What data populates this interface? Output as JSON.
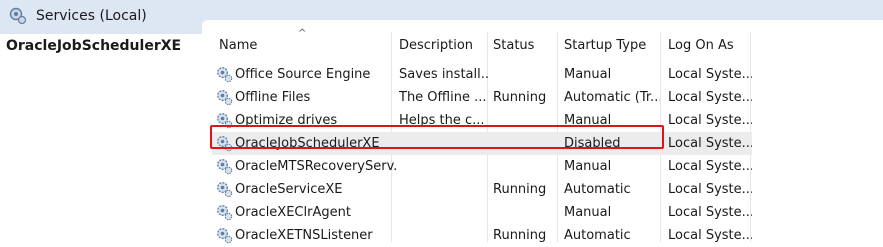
{
  "header": {
    "title": "Services (Local)",
    "icon": "services-icon"
  },
  "left_pane": {
    "selected_service": "OracleJobSchedulerXE"
  },
  "columns": [
    "Name",
    "Description",
    "Status",
    "Startup Type",
    "Log On As"
  ],
  "rows": [
    {
      "name": "Office  Source Engine",
      "description": "Saves install...",
      "status": "",
      "startup": "Manual",
      "logon": "Local Syste..."
    },
    {
      "name": "Offline Files",
      "description": "The Offline ...",
      "status": "Running",
      "startup": "Automatic (Tr...",
      "logon": "Local Syste..."
    },
    {
      "name": "Optimize drives",
      "description": "Helps the c...",
      "status": "",
      "startup": "Manual",
      "logon": "Local Syste..."
    },
    {
      "name": "OracleJobSchedulerXE",
      "description": "",
      "status": "",
      "startup": "Disabled",
      "logon": "Local Syste..."
    },
    {
      "name": "OracleMTSRecoveryServ...",
      "description": "",
      "status": "",
      "startup": "Manual",
      "logon": "Local Syste..."
    },
    {
      "name": "OracleServiceXE",
      "description": "",
      "status": "Running",
      "startup": "Automatic",
      "logon": "Local Syste..."
    },
    {
      "name": "OracleXEClrAgent",
      "description": "",
      "status": "",
      "startup": "Manual",
      "logon": "Local Syste..."
    },
    {
      "name": "OracleXETNSListener",
      "description": "",
      "status": "Running",
      "startup": "Automatic",
      "logon": "Local Syste..."
    }
  ],
  "colors": {
    "header_bg": "#dde7f3",
    "highlight_border": "#e0131a",
    "selected_row_bg": "#ececec"
  }
}
